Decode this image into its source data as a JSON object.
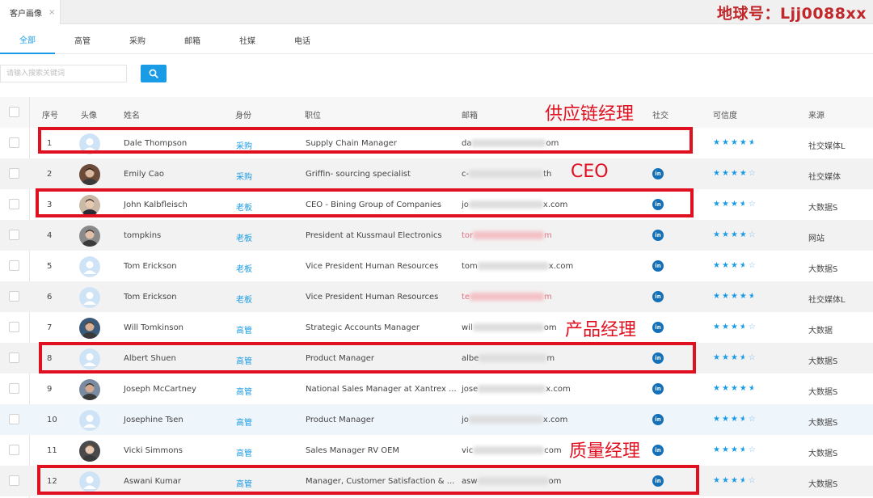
{
  "watermark": "地球号：Ljj0088xx",
  "doc_tab": {
    "label": "客户画像",
    "close": "×"
  },
  "filter_tabs": [
    "全部",
    "高管",
    "采购",
    "邮箱",
    "社媒",
    "电话"
  ],
  "search": {
    "placeholder": "请输入搜索关键词"
  },
  "table": {
    "headers": [
      "序号",
      "头像",
      "姓名",
      "身份",
      "职位",
      "邮箱",
      "社交",
      "可信度",
      "来源"
    ],
    "rows": [
      {
        "no": "1",
        "name": "Dale Thompson",
        "role": "采购",
        "position": "Supply Chain Manager",
        "email_start": "da",
        "email_end": "om",
        "email_red": false,
        "linkedin": false,
        "stars": 4.5,
        "source": "社交媒体L"
      },
      {
        "no": "2",
        "name": "Emily Cao",
        "role": "采购",
        "position": "Griffin- sourcing specialist",
        "email_start": "c-",
        "email_end": "th",
        "email_red": false,
        "linkedin": true,
        "stars": 4,
        "source": "社交媒体"
      },
      {
        "no": "3",
        "name": "John Kalbfleisch",
        "role": "老板",
        "position": "CEO - Bining Group of Companies",
        "email_start": "jo",
        "email_end": "x.com",
        "email_red": false,
        "linkedin": true,
        "stars": 3.5,
        "source": "大数据S"
      },
      {
        "no": "4",
        "name": "tompkins",
        "role": "老板",
        "position": "President at Kussmaul Electronics",
        "email_start": "tor",
        "email_end": "m",
        "email_red": true,
        "linkedin": true,
        "stars": 4,
        "source": "网站"
      },
      {
        "no": "5",
        "name": "Tom Erickson",
        "role": "老板",
        "position": "Vice President Human Resources",
        "email_start": "tom",
        "email_end": "x.com",
        "email_red": false,
        "linkedin": true,
        "stars": 3.5,
        "source": "大数据S"
      },
      {
        "no": "6",
        "name": "Tom Erickson",
        "role": "老板",
        "position": "Vice President Human Resources",
        "email_start": "te",
        "email_end": "m",
        "email_red": true,
        "linkedin": true,
        "stars": 4.5,
        "source": "社交媒体L"
      },
      {
        "no": "7",
        "name": "Will Tomkinson",
        "role": "高管",
        "position": "Strategic Accounts Manager",
        "email_start": "wil",
        "email_end": "om",
        "email_red": false,
        "linkedin": true,
        "stars": 3.5,
        "source": "大数据"
      },
      {
        "no": "8",
        "name": "Albert Shuen",
        "role": "高管",
        "position": "Product Manager",
        "email_start": "albe",
        "email_end": "m",
        "email_red": false,
        "linkedin": true,
        "stars": 3.5,
        "source": "大数据S"
      },
      {
        "no": "9",
        "name": "Joseph McCartney",
        "role": "高管",
        "position": "National Sales Manager at Xantrex ...",
        "email_start": "jose",
        "email_end": "x.com",
        "email_red": false,
        "linkedin": true,
        "stars": 4.5,
        "source": "大数据S"
      },
      {
        "no": "10",
        "name": "Josephine Tsen",
        "role": "高管",
        "position": "Product Manager",
        "email_start": "jo",
        "email_end": "x.com",
        "email_red": false,
        "linkedin": true,
        "stars": 3.5,
        "source": "大数据S"
      },
      {
        "no": "11",
        "name": "Vicki Simmons",
        "role": "高管",
        "position": "Sales Manager RV OEM",
        "email_start": "vic",
        "email_end": "com",
        "email_red": false,
        "linkedin": true,
        "stars": 3.5,
        "source": "大数据S"
      },
      {
        "no": "12",
        "name": "Aswani Kumar",
        "role": "高管",
        "position": "Manager, Customer Satisfaction & ...",
        "email_start": "asw",
        "email_end": "om",
        "email_red": false,
        "linkedin": true,
        "stars": 3.5,
        "source": "大数据S"
      }
    ]
  },
  "annotations": [
    "供应链经理",
    "CEO",
    "产品经理",
    "质量经理"
  ],
  "colors": {
    "accent": "#1a9be6",
    "annotation": "#e01020",
    "linkedin": "#1470b8"
  }
}
